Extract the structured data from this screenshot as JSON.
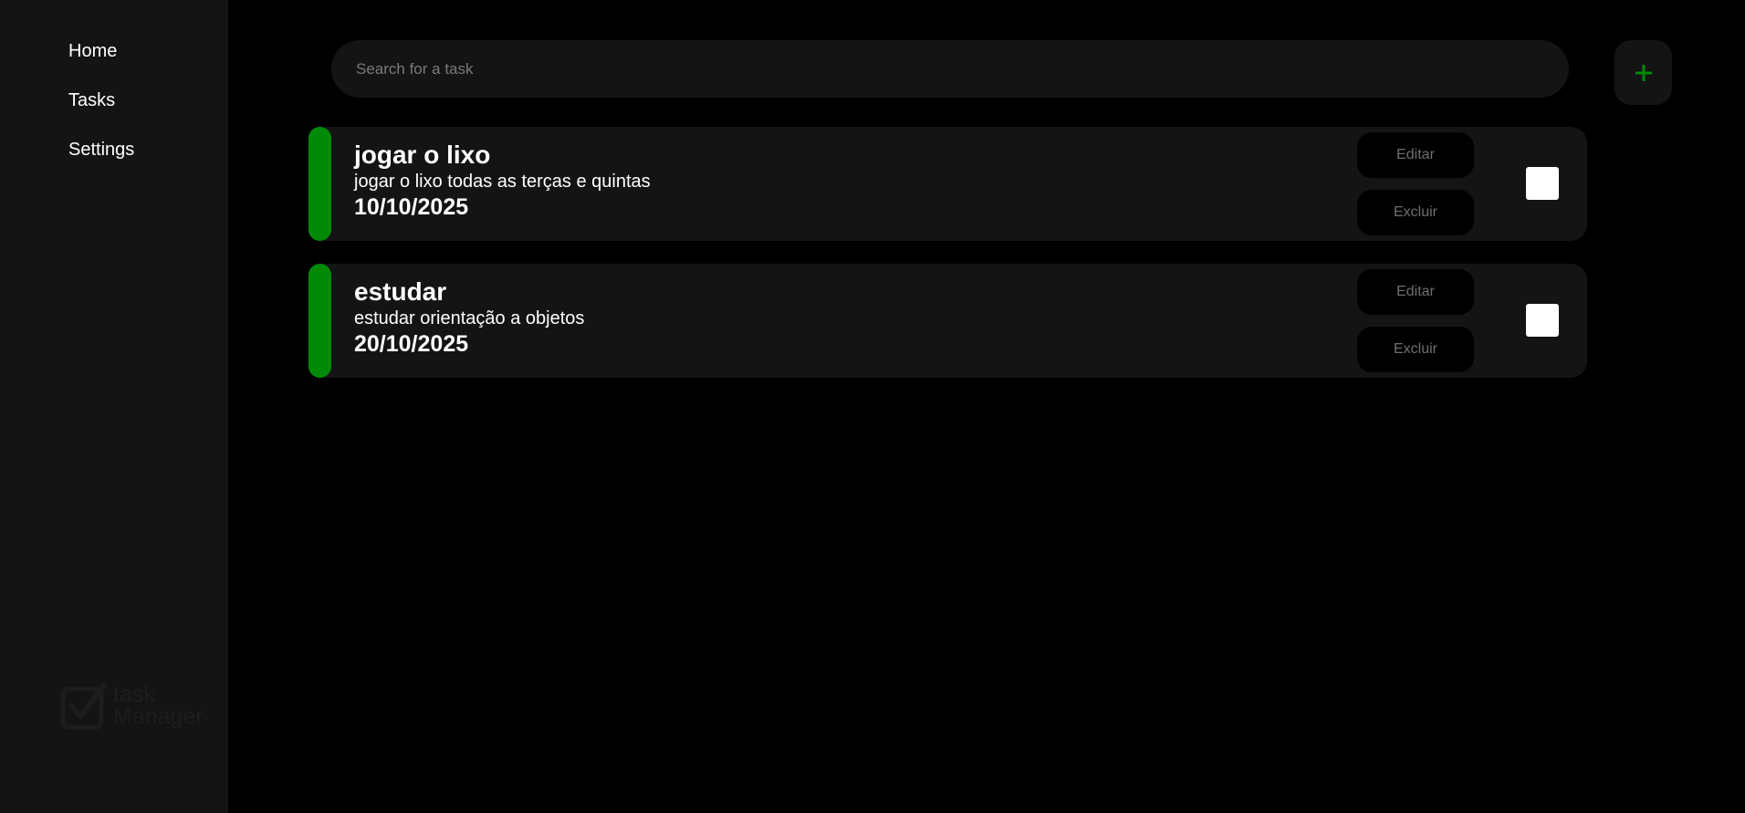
{
  "sidebar": {
    "items": [
      {
        "label": "Home"
      },
      {
        "label": "Tasks"
      },
      {
        "label": "Settings"
      }
    ],
    "logo": {
      "line1": "task",
      "line2": "Manager"
    }
  },
  "search": {
    "placeholder": "Search for a task",
    "value": ""
  },
  "add_button": {
    "label": "+",
    "icon": "plus-icon"
  },
  "tasks": [
    {
      "title": "jogar o lixo",
      "description": "jogar o lixo todas as terças e quintas",
      "date": "10/10/2025",
      "edit_label": "Editar",
      "delete_label": "Excluir",
      "checked": false
    },
    {
      "title": "estudar",
      "description": "estudar orientação a objetos",
      "date": "20/10/2025",
      "edit_label": "Editar",
      "delete_label": "Excluir",
      "checked": false
    }
  ],
  "colors": {
    "background": "#000000",
    "panel": "#141414",
    "accent": "#008a08",
    "button_text": "#6f6f6f"
  }
}
